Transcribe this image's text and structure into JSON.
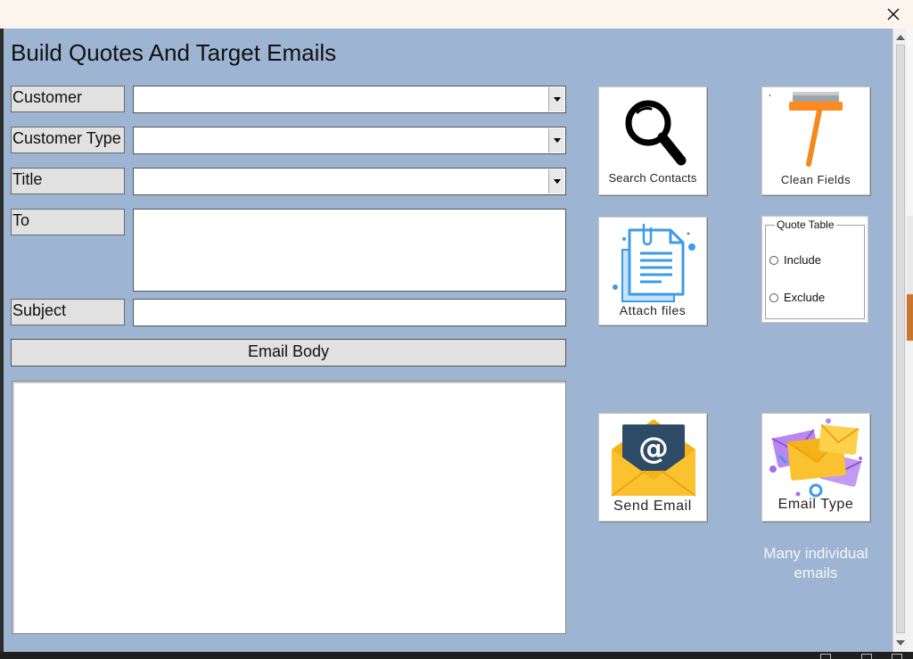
{
  "window": {
    "close_glyph": "✕"
  },
  "form": {
    "title": "Build Quotes And Target Emails",
    "background": "#9db5d3",
    "fields": {
      "customer_label": "Customer",
      "customer_type_label": "Customer Type",
      "title_label": "Title",
      "to_label": "To",
      "subject_label": "Subject",
      "email_body_label": "Email Body"
    },
    "buttons": {
      "search_contacts": "Search Contacts",
      "clean_fields": "Clean Fields",
      "attach_files": "Attach files",
      "send_email": "Send Email",
      "email_type": "Email Type"
    },
    "quote_table": {
      "title": "Quote Table",
      "include_label": "Include",
      "exclude_label": "Exclude"
    },
    "email_mode_text": "Many individual emails"
  },
  "icons": {
    "search": "magnifier-icon",
    "clean": "broom-icon",
    "attach": "document-paperclip-icon",
    "send": "envelope-at-icon",
    "email_type": "multiple-envelopes-icon",
    "close": "close-icon"
  },
  "colors": {
    "label_bg": "#e1e1e1",
    "broom_handle": "#f28a1e",
    "envelope_yellow": "#f9c22e",
    "envelope_purple": "#b887f0",
    "doc_blue": "#3c9be8"
  }
}
